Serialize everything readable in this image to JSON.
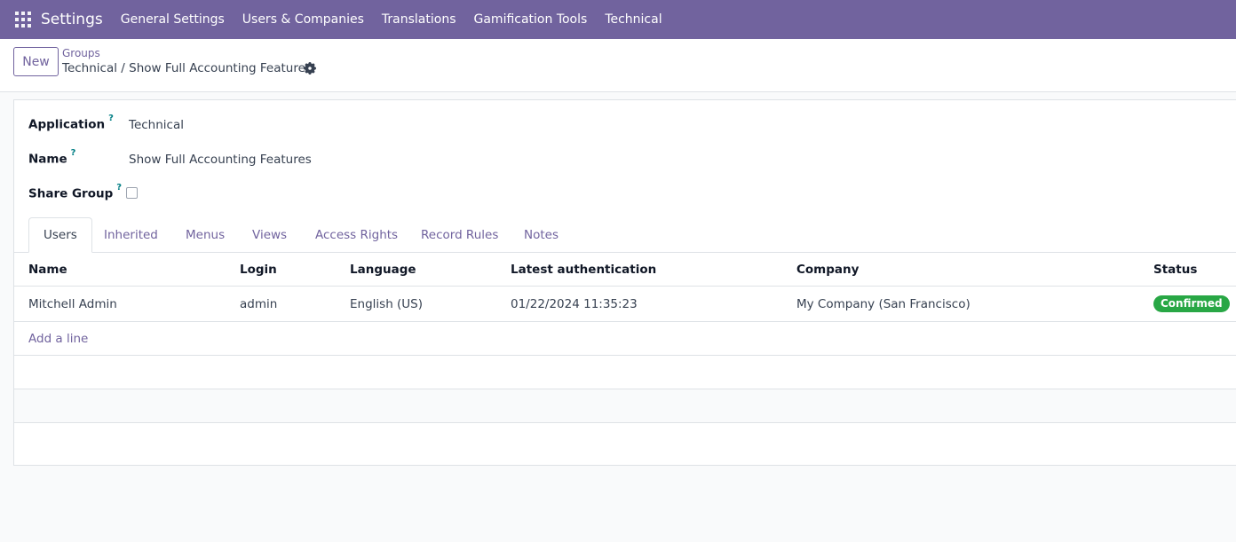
{
  "navbar": {
    "brand": "Settings",
    "menu": [
      {
        "label": "General Settings"
      },
      {
        "label": "Users & Companies"
      },
      {
        "label": "Translations"
      },
      {
        "label": "Gamification Tools"
      },
      {
        "label": "Technical"
      }
    ]
  },
  "control_panel": {
    "new_label": "New",
    "breadcrumb_parent": "Groups",
    "breadcrumb_current": "Technical / Show Full Accounting Features"
  },
  "form": {
    "application_label": "Application",
    "application_value": "Technical",
    "name_label": "Name",
    "name_value": "Show Full Accounting Features",
    "share_group_label": "Share Group",
    "share_group_checked": false,
    "help_marker": "?"
  },
  "tabs": [
    {
      "label": "Users",
      "active": true
    },
    {
      "label": "Inherited"
    },
    {
      "label": "Menus"
    },
    {
      "label": "Views"
    },
    {
      "label": "Access Rights"
    },
    {
      "label": "Record Rules"
    },
    {
      "label": "Notes"
    }
  ],
  "users_table": {
    "columns": [
      "Name",
      "Login",
      "Language",
      "Latest authentication",
      "Company",
      "Status"
    ],
    "rows": [
      {
        "name": "Mitchell Admin",
        "login": "admin",
        "language": "English (US)",
        "latest_auth": "01/22/2024 11:35:23",
        "company": "My Company (San Francisco)",
        "status": "Confirmed"
      }
    ],
    "add_line": "Add a line"
  },
  "colors": {
    "navbar": "#71639e",
    "accent": "#71639e",
    "status_confirmed": "#28a745"
  }
}
